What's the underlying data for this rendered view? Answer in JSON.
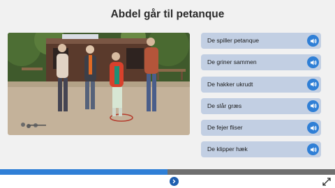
{
  "title": "Abdel går til petanque",
  "options": [
    {
      "label": "De spiller petanque",
      "icon": "speaker-icon"
    },
    {
      "label": "De griner sammen",
      "icon": "speaker-icon"
    },
    {
      "label": "De hakker ukrudt",
      "icon": "speaker-icon"
    },
    {
      "label": "De slår græs",
      "icon": "speaker-icon"
    },
    {
      "label": "De fejer fliser",
      "icon": "speaker-icon"
    },
    {
      "label": "De klipper hæk",
      "icon": "speaker-icon"
    }
  ],
  "progress": 0.5,
  "colors": {
    "accent": "#2f7fd6",
    "option_bg": "#c2cfe3",
    "track": "#6f6f6f",
    "nav": "#1f5fb0"
  }
}
